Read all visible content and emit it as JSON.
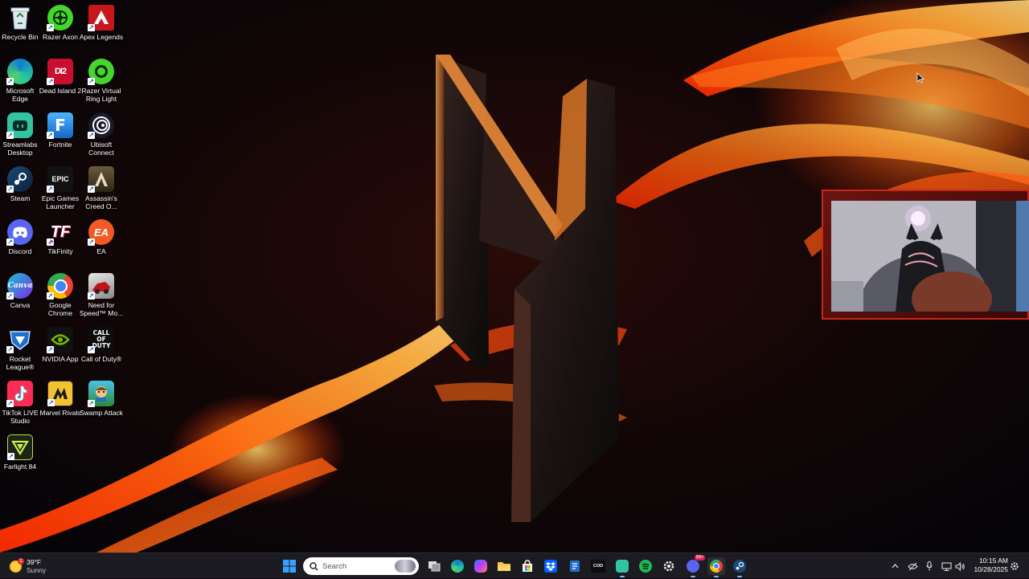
{
  "desktop": {
    "icons": [
      {
        "label": "Recycle Bin",
        "icon": "recycle-bin-icon"
      },
      {
        "label": "Razer Axon",
        "icon": "razer-axon-icon"
      },
      {
        "label": "Apex Legends",
        "icon": "apex-legends-icon"
      },
      {
        "label": "Microsoft Edge",
        "icon": "edge-icon"
      },
      {
        "label": "Dead Island 2",
        "icon": "dead-island-icon",
        "glyph": "DI2"
      },
      {
        "label": "Razer Virtual Ring Light",
        "icon": "ring-light-icon"
      },
      {
        "label": "Streamlabs Desktop",
        "icon": "streamlabs-icon"
      },
      {
        "label": "Fortnite",
        "icon": "fortnite-icon",
        "glyph": "F"
      },
      {
        "label": "Ubisoft Connect",
        "icon": "ubisoft-icon"
      },
      {
        "label": "Steam",
        "icon": "steam-icon"
      },
      {
        "label": "Epic Games Launcher",
        "icon": "epic-games-icon",
        "glyph": "EPIC"
      },
      {
        "label": "Assassin's Creed O...",
        "icon": "assassins-creed-icon"
      },
      {
        "label": "Discord",
        "icon": "discord-icon"
      },
      {
        "label": "TikFinity",
        "icon": "tikfinity-icon",
        "glyph": "TF"
      },
      {
        "label": "EA",
        "icon": "ea-icon",
        "glyph": "EA"
      },
      {
        "label": "Canva",
        "icon": "canva-icon",
        "glyph": "Canva"
      },
      {
        "label": "Google Chrome",
        "icon": "chrome-icon"
      },
      {
        "label": "Need for Speed™ Mo...",
        "icon": "need-for-speed-icon"
      },
      {
        "label": "Rocket League®",
        "icon": "rocket-league-icon"
      },
      {
        "label": "NVIDIA App",
        "icon": "nvidia-icon"
      },
      {
        "label": "Call of Duty®",
        "icon": "call-of-duty-icon",
        "glyph": "CALL OF DUTY"
      },
      {
        "label": "TikTok LIVE Studio",
        "icon": "tiktok-live-icon"
      },
      {
        "label": "Marvel Rivals",
        "icon": "marvel-rivals-icon"
      },
      {
        "label": "Swamp Attack",
        "icon": "swamp-attack-icon"
      },
      {
        "label": "Farlight 84",
        "icon": "farlight-icon"
      }
    ]
  },
  "taskbar": {
    "weather": {
      "temp": "39°F",
      "condition": "Sunny",
      "badge": "1"
    },
    "search": {
      "placeholder": "Search"
    },
    "apps": [
      "start-icon",
      "task-view-icon",
      "edge-icon",
      "copilot-icon",
      "file-explorer-icon",
      "microsoft-store-icon",
      "dropbox-icon",
      "app-icon",
      "call-of-duty-icon",
      "streamlabs-icon",
      "spotify-icon",
      "settings-icon",
      "discord-icon",
      "chrome-icon",
      "steam-icon"
    ],
    "discord_badge": "99+",
    "clock": {
      "time": "10:15 AM",
      "date": "10/28/2025"
    }
  },
  "colors": {
    "accent": "#0078d4",
    "taskbar": "#1c1b21",
    "flame": "#ff5a14"
  }
}
